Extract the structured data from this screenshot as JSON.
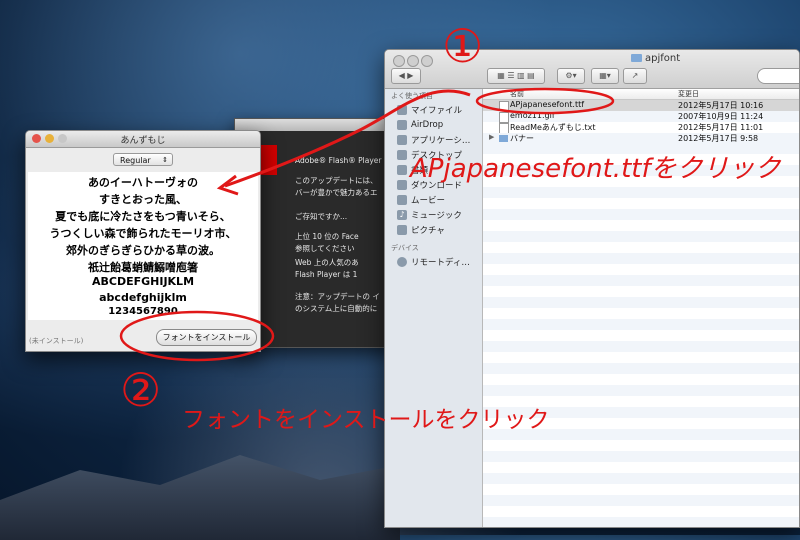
{
  "finder": {
    "title": "apjfont",
    "sidebar_favorites_header": "よく使う項目",
    "sidebar_devices_header": "デバイス",
    "favorites": [
      "マイファイル",
      "AirDrop",
      "アプリケーシ…",
      "デスクトップ",
      "書類",
      "ダウンロード",
      "ムービー",
      "ミュージック",
      "ピクチャ"
    ],
    "devices": [
      "リモートディ…"
    ],
    "columns": {
      "name": "名前",
      "date": "変更日"
    },
    "files": [
      {
        "name": "APjapanesefont.ttf",
        "date": "2012年5月17日 10:16"
      },
      {
        "name": "emoz11.gif",
        "date": "2007年10月9日 11:24"
      },
      {
        "name": "ReadMeあんずもじ.txt",
        "date": "2012年5月17日 11:01"
      },
      {
        "name": "バナー",
        "date": "2012年5月17日 9:58"
      }
    ]
  },
  "flash": {
    "lines": [
      "このアップデートには、",
      "バーが豊かで魅力あるエ",
      "ご存知ですか...",
      "上位 10 位の Face",
      "参照してください",
      "Web 上の人気のあ",
      "Flash Player は 1",
      "注意：アップデートの イ",
      "のシステム上に自動的に"
    ],
    "heading": "Adobe® Flash® Player の"
  },
  "font_window": {
    "title": "あんずもじ",
    "style_selected": "Regular",
    "preview_lines": [
      "あのイーハトーヴォの",
      "すきとおった風、",
      "夏でも底に冷たさをもつ青いそら、",
      "うつくしい森で飾られたモーリオ市、",
      "郊外のぎらぎらひかる草の波。",
      "祇辻飴葛蛸鯖鰯噌庖箸",
      "ABCDEFGHIJKLM",
      "abcdefghijklm",
      "1234567890"
    ],
    "status": "(未インストール)",
    "install_button": "フォントをインストール"
  },
  "annotations": {
    "step1_number": "①",
    "step1_text": "APjapanesefont.ttfをクリック",
    "step2_number": "②",
    "step2_text": "フォントをインストールをクリック",
    "accent_color": "#e01818"
  }
}
